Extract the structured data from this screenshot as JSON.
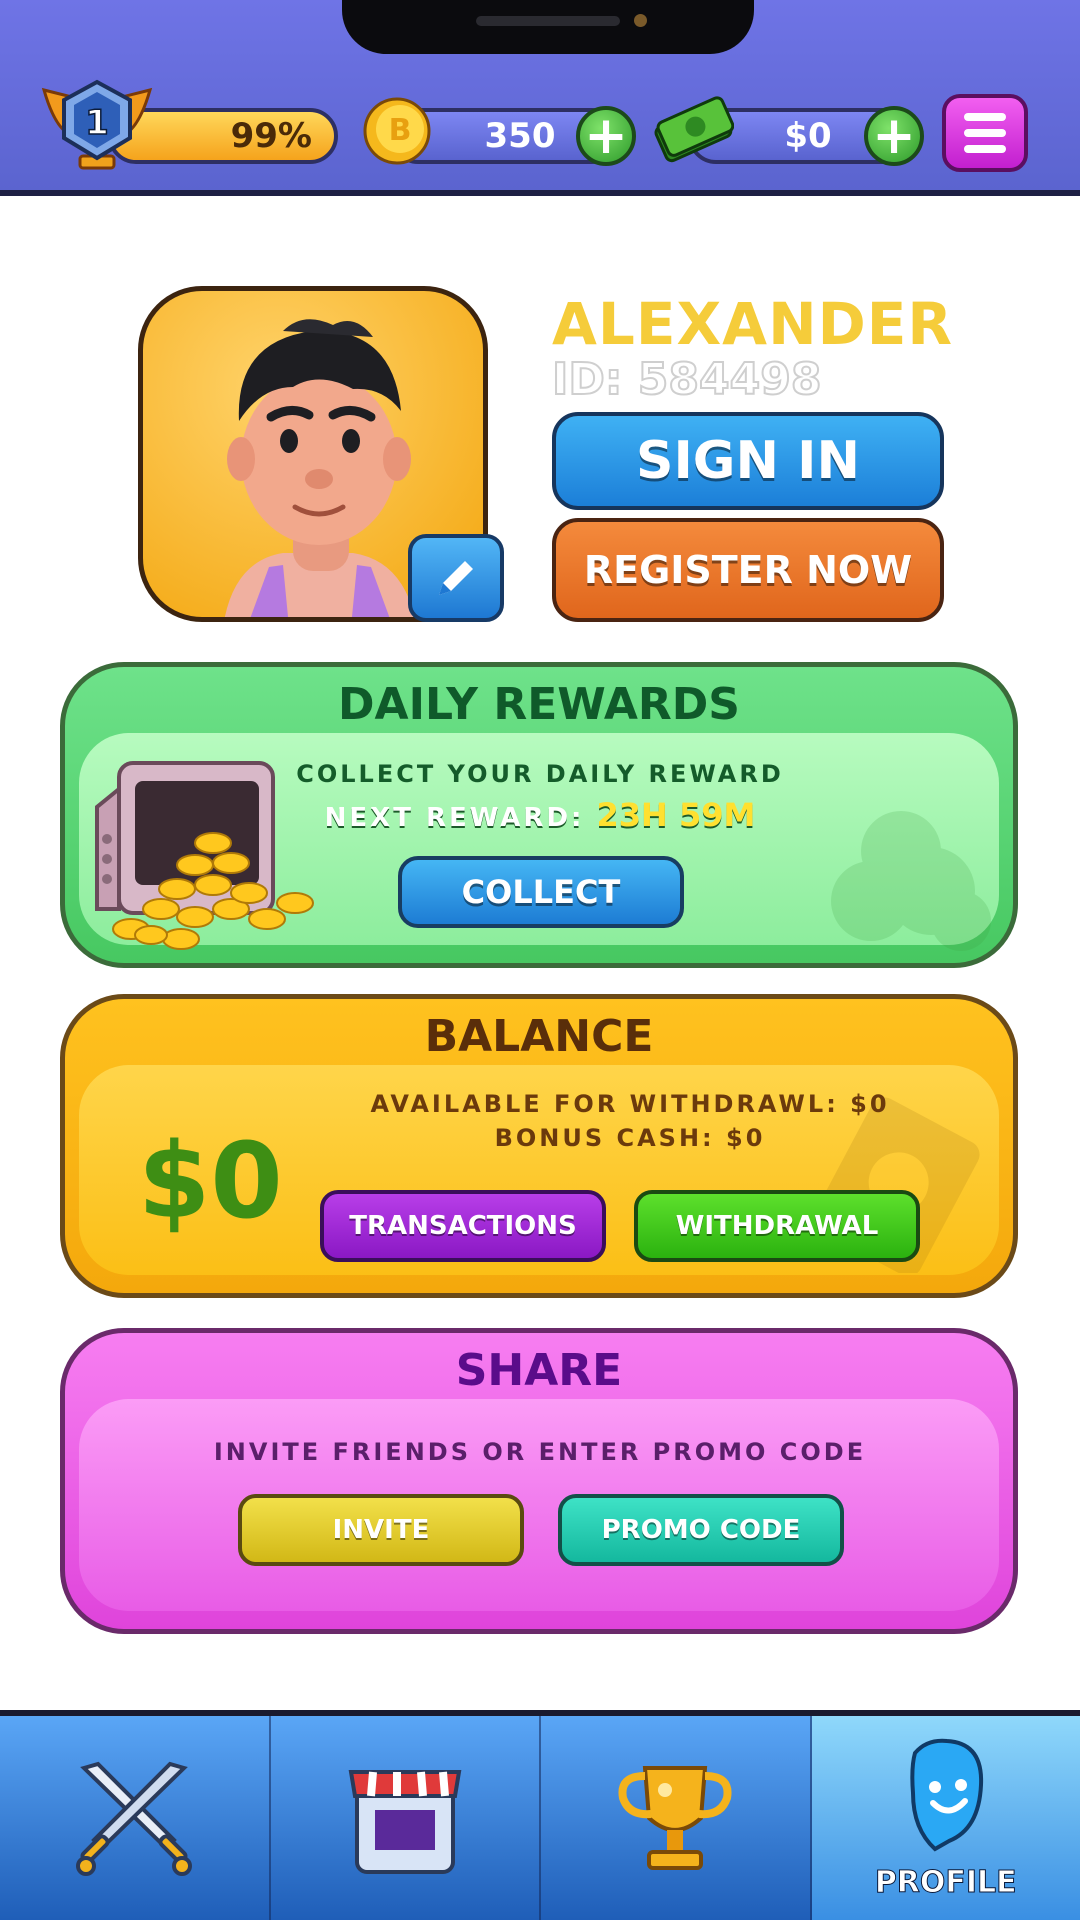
{
  "header": {
    "level": "1",
    "level_progress": "99%",
    "coins": "350",
    "cash": "$0"
  },
  "profile": {
    "name": "ALEXANDER",
    "id": "ID: 584498",
    "sign_in_label": "SIGN IN",
    "register_label": "REGISTER NOW"
  },
  "daily_rewards": {
    "title": "DAILY REWARDS",
    "line1": "COLLECT YOUR DAILY REWARD",
    "next_label": "NEXT REWARD:",
    "timer": "23H 59M",
    "collect_label": "COLLECT"
  },
  "balance": {
    "title": "BALANCE",
    "amount": "$0",
    "available": "AVAILABLE FOR WITHDRAWL: $0",
    "bonus": "BONUS CASH: $0",
    "transactions_label": "TRANSACTIONS",
    "withdrawal_label": "WITHDRAWAL"
  },
  "share": {
    "title": "SHARE",
    "line": "INVITE FRIENDS OR ENTER PROMO CODE",
    "invite_label": "INVITE",
    "promo_label": "PROMO CODE"
  },
  "nav": {
    "items": [
      {
        "icon": "crossed-swords-icon",
        "label": ""
      },
      {
        "icon": "shop-icon",
        "label": ""
      },
      {
        "icon": "trophy-icon",
        "label": ""
      },
      {
        "icon": "profile-icon",
        "label": "PROFILE"
      }
    ],
    "active_index": 3
  },
  "colors": {
    "header_bg": "#6f74e6",
    "name_gold": "#f5cc3a",
    "daily_green": "#6ee28a",
    "balance_yellow": "#ffc21f",
    "share_pink": "#f77ef1",
    "nav_blue": "#5aa6f6"
  }
}
